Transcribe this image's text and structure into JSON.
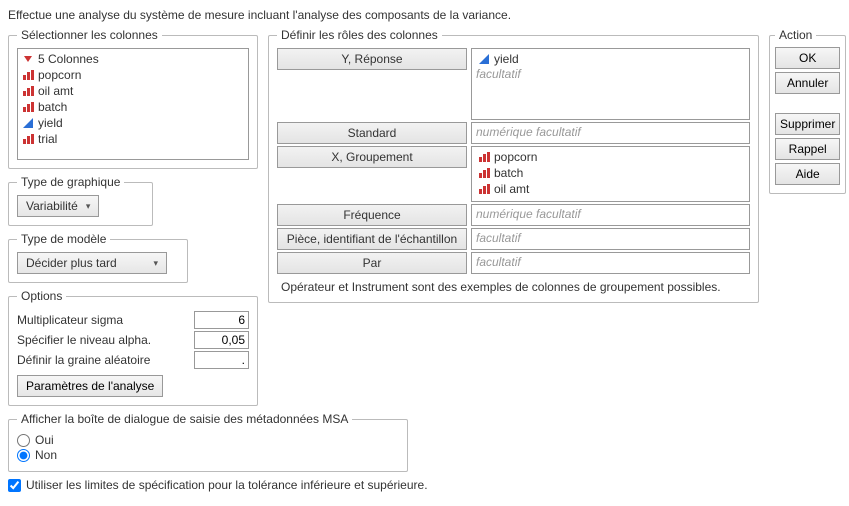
{
  "description": "Effectue une analyse du système de mesure incluant l'analyse des composants de la variance.",
  "selectColumns": {
    "legend": "Sélectionner les colonnes",
    "countLabel": "5 Colonnes",
    "items": [
      "popcorn",
      "oil amt",
      "batch",
      "yield",
      "trial"
    ],
    "types": [
      "nominal",
      "nominal",
      "nominal",
      "continuous",
      "nominal"
    ]
  },
  "chartType": {
    "legend": "Type de graphique",
    "value": "Variabilité"
  },
  "modelType": {
    "legend": "Type de modèle",
    "value": "Décider plus tard"
  },
  "options": {
    "legend": "Options",
    "sigmaLabel": "Multiplicateur sigma",
    "sigmaValue": "6",
    "alphaLabel": "Spécifier le niveau alpha.",
    "alphaValue": "0,05",
    "seedLabel": "Définir la graine aléatoire",
    "seedValue": ".",
    "paramsBtn": "Paramètres de l'analyse"
  },
  "msa": {
    "legend": "Afficher la boîte de dialogue de saisie des métadonnées MSA",
    "yes": "Oui",
    "no": "Non",
    "selected": "no"
  },
  "specLimits": {
    "label": "Utiliser les limites de spécification pour la tolérance inférieure et supérieure.",
    "checked": true
  },
  "roles": {
    "legend": "Définir les rôles des colonnes",
    "yLabel": "Y, Réponse",
    "yItems": [
      "yield"
    ],
    "yPlaceholder": "facultatif",
    "standardLabel": "Standard",
    "standardPlaceholder": "numérique facultatif",
    "xLabel": "X, Groupement",
    "xItems": [
      "popcorn",
      "batch",
      "oil amt"
    ],
    "freqLabel": "Fréquence",
    "freqPlaceholder": "numérique facultatif",
    "pieceLabel": "Pièce, identifiant de l'échantillon",
    "piecePlaceholder": "facultatif",
    "byLabel": "Par",
    "byPlaceholder": "facultatif",
    "note": "Opérateur et Instrument sont des exemples de colonnes de groupement possibles."
  },
  "action": {
    "legend": "Action",
    "ok": "OK",
    "cancel": "Annuler",
    "remove": "Supprimer",
    "recall": "Rappel",
    "help": "Aide"
  }
}
